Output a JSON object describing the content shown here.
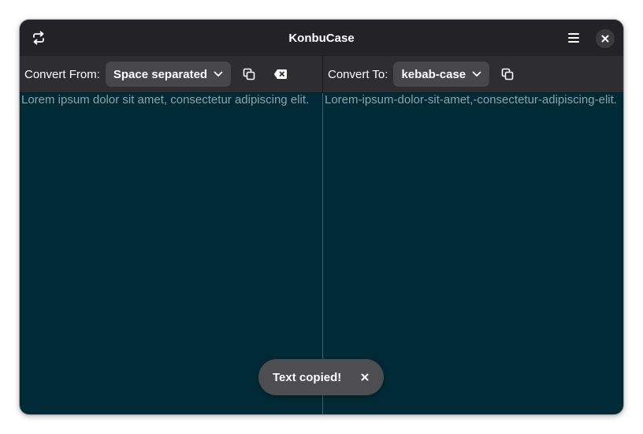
{
  "app": {
    "title": "KonbuCase",
    "colors": {
      "headerbar": "#232327",
      "toolbar": "#2e2e32",
      "content": "#002a35",
      "accent_text": "#ffffff",
      "placeholder_text": "#8ea3ab"
    }
  },
  "titlebar": {
    "left_icon": "swap-arrows-icon",
    "menu_icon": "hamburger-menu-icon",
    "close_icon": "close-icon"
  },
  "source": {
    "label": "Convert From:",
    "selected_case": "Space separated",
    "copy_icon": "copy-icon",
    "clear_icon": "backspace-clear-icon",
    "text": "Lorem ipsum dolor sit amet, consectetur adipiscing elit."
  },
  "target": {
    "label": "Convert To:",
    "selected_case": "kebab-case",
    "copy_icon": "copy-icon",
    "text": "Lorem-ipsum-dolor-sit-amet,-consectetur-adipiscing-elit."
  },
  "toast": {
    "message": "Text copied!",
    "close_icon": "close-icon"
  }
}
